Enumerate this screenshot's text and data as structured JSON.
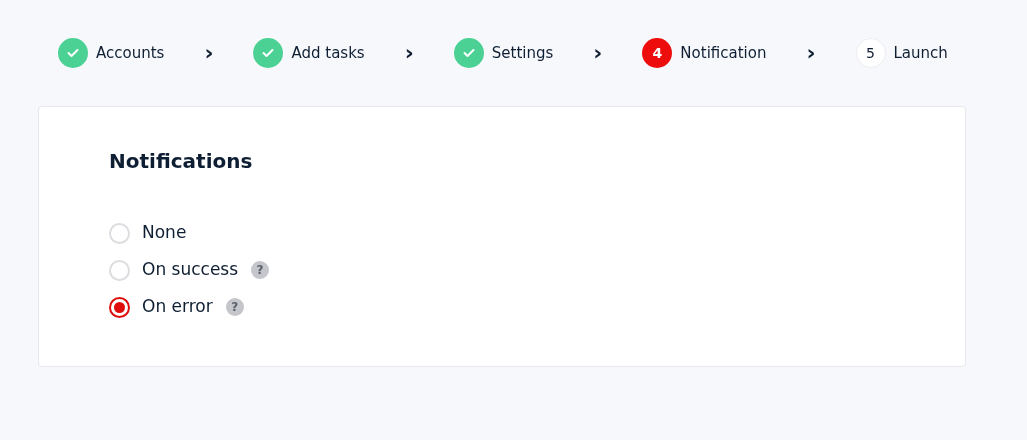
{
  "steps": [
    {
      "kind": "done",
      "label": "Accounts",
      "separator": "›"
    },
    {
      "kind": "done",
      "label": "Add tasks",
      "separator": "›"
    },
    {
      "kind": "done",
      "label": "Settings",
      "separator": "›"
    },
    {
      "kind": "active",
      "number": "4",
      "label": "Notification",
      "separator": "›"
    },
    {
      "kind": "pending",
      "number": "5",
      "label": "Launch"
    }
  ],
  "card": {
    "title": "Notifications",
    "options": [
      {
        "label": "None",
        "selected": false
      },
      {
        "label": "On success",
        "selected": false,
        "help": "?"
      },
      {
        "label": "On error",
        "selected": true,
        "help": "?"
      }
    ]
  }
}
